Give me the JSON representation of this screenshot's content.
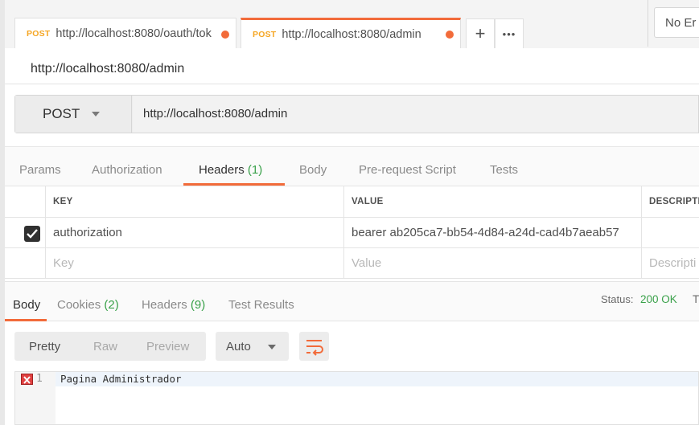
{
  "tabs": [
    {
      "method": "POST",
      "url": "http://localhost:8080/oauth/tok",
      "unsaved": true
    },
    {
      "method": "POST",
      "url": "http://localhost:8080/admin",
      "unsaved": true
    }
  ],
  "tab_actions": {
    "new_tab": "+",
    "more": "•••"
  },
  "environment": {
    "selected": "No Er"
  },
  "request": {
    "title": "http://localhost:8080/admin",
    "method": "POST",
    "url": "http://localhost:8080/admin"
  },
  "request_tabs": {
    "params": "Params",
    "authorization": "Authorization",
    "headers": "Headers",
    "headers_count": "(1)",
    "body": "Body",
    "prerequest": "Pre-request Script",
    "tests": "Tests"
  },
  "headers_table": {
    "columns": {
      "key": "KEY",
      "value": "VALUE",
      "description": "DESCRIPTI"
    },
    "rows": [
      {
        "enabled": true,
        "key": "authorization",
        "value": "bearer ab205ca7-bb54-4d84-a24d-cad4b7aeab57",
        "description": ""
      }
    ],
    "placeholder": {
      "key": "Key",
      "value": "Value",
      "description": "Descripti"
    }
  },
  "response_tabs": {
    "body": "Body",
    "cookies": "Cookies",
    "cookies_count": "(2)",
    "headers": "Headers",
    "headers_count": "(9)",
    "test_results": "Test Results"
  },
  "status": {
    "label": "Status:",
    "value": "200 OK",
    "trailing": "T"
  },
  "format": {
    "pretty": "Pretty",
    "raw": "Raw",
    "preview": "Preview",
    "language": "Auto"
  },
  "editor": {
    "line_number": "1",
    "content": "Pagina Administrador"
  },
  "colors": {
    "accent": "#f26b3a",
    "method": "#f5a623",
    "success": "#3aa14a"
  },
  "icons": {
    "wrap": "wrap-lines-icon",
    "dropdown": "chevron-down-icon",
    "checkbox": "check-icon",
    "error": "error-icon"
  }
}
